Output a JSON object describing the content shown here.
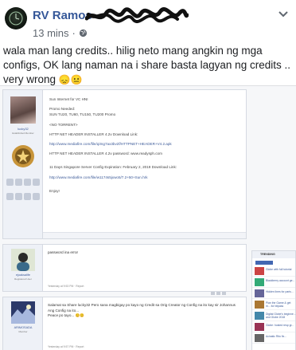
{
  "post": {
    "author": "RV Ramos",
    "time": "13 mins",
    "separator": "·",
    "text_line1": "wala man lang credits.. hilig neto mang angkin ng mga",
    "text_line2": "configs, OK lang naman na i share basta lagyan ng credits ..",
    "text_line3": "very wrong",
    "emoji": "😞😐"
  },
  "forum": {
    "username": "lucky32",
    "rank": "Established Member",
    "lines": [
      "Sun Internet for VC HNI",
      "",
      "Promo Needed:",
      "SUN TU20, TU60, TU150, TU200 Promo",
      "",
      "<NO TORRENT>",
      "",
      "HTTP NET HEADER INSTALLER 4.2v Download Link:",
      "",
      "http://www.mediafire.com/file/q3ng7ax3bv2f/HTTPNET+HEADER+V4.2.apk",
      "",
      "HTTP NET HEADER INSTALLER 4.2v password: www.readysph.com",
      "",
      "",
      "11 Days Singapore Server Config Expiration: February 2, 2019 Download Link:",
      "",
      "http://www.mediafire.com/file/w1174s5jxwo5/7.2+50+Sun.hrk",
      "",
      "",
      "Enjoy!"
    ],
    "replies": [
      {
        "username": "ejoaksalife",
        "rank": "Registered User",
        "body": "password ina error",
        "footer": "Yesterday at 9:53 PM · Report"
      },
      {
        "username": "ARIMOSADA",
        "rank": "Member",
        "body_line1": "Salamat sa Share lucky32 Pero sana magbigay po kayo ng Credit sa Orig Creator ng Config na ito kay sir Johannus",
        "body_line2": "Ang Config na ito...",
        "body_line3": "Peace po tayo... 😊😊",
        "footer": "Yesterday at 9:57 PM · Report"
      }
    ],
    "sidebar": {
      "title": "TRENDING",
      "items": [
        "Globe with full tutorial",
        "Blackberry account ge...",
        "Hidden lines for paris...",
        "Plan the Game & get m... for bitpass",
        "Digital Globe's beginne... and Globe 2018",
        "Globe: hosted resp gr...",
        "Acinatic Rito fix..."
      ]
    }
  },
  "colors": {
    "author_link": "#365899",
    "forum_link": "#3b5998",
    "muted": "#606770"
  }
}
